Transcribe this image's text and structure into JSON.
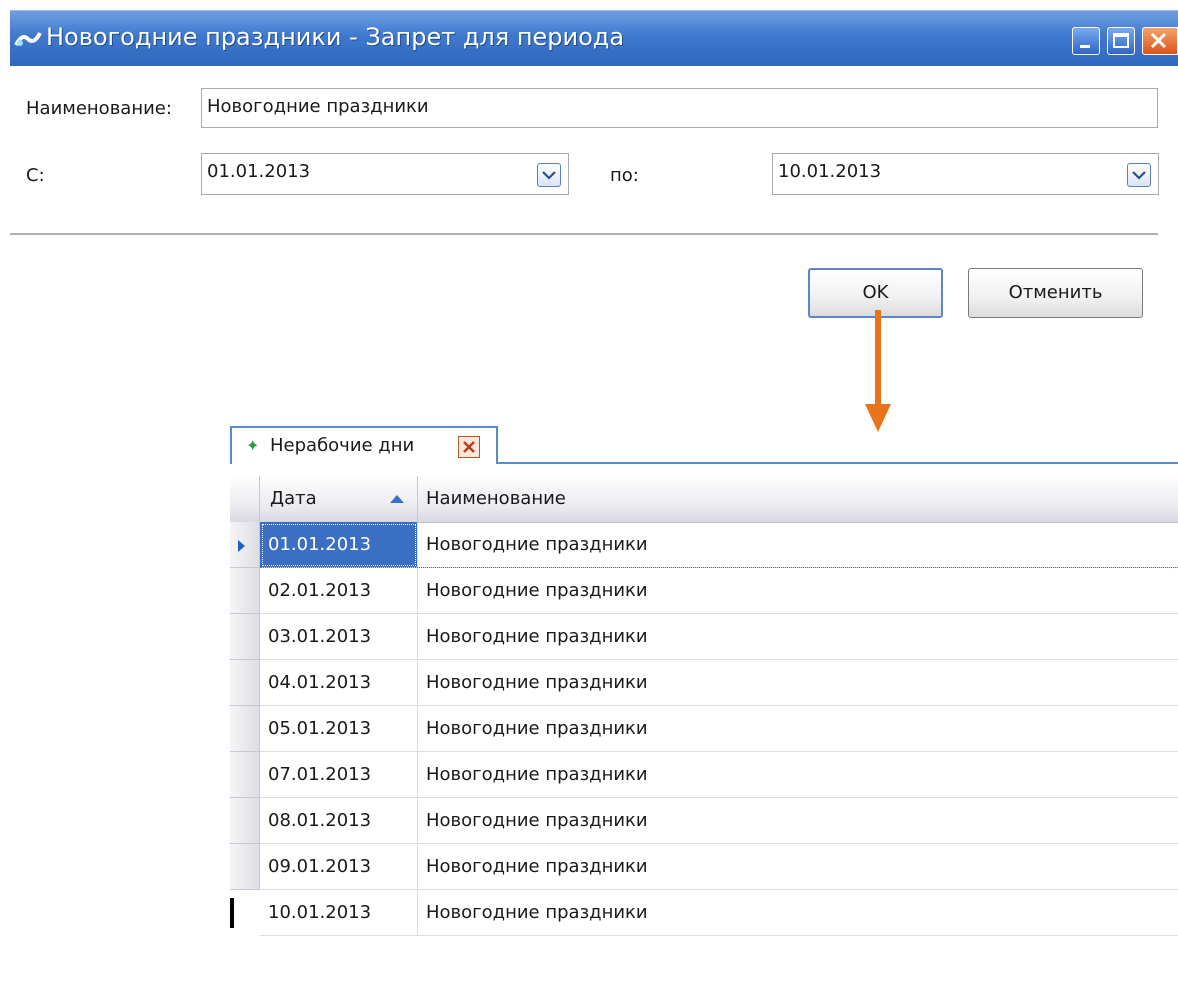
{
  "window": {
    "title": "Новогодние праздники - Запрет для периода",
    "controls": [
      "minimize",
      "maximize",
      "close"
    ]
  },
  "form": {
    "name_label": "Наименование:",
    "name_value": "Новогодние праздники",
    "from_label": "С:",
    "from_value": "01.01.2013",
    "to_label": "по:",
    "to_value": "10.01.2013"
  },
  "buttons": {
    "ok": "OK",
    "cancel": "Отменить"
  },
  "annotation": {
    "arrow_color": "#e8731a"
  },
  "tab": {
    "label": "Нерабочие дни",
    "icon": "star-icon"
  },
  "grid": {
    "columns": [
      "Дата",
      "Наименование"
    ],
    "sort_column": "Дата",
    "sort_direction": "ascending",
    "selected_row": 0,
    "rows": [
      {
        "date": "01.01.2013",
        "name": "Новогодние праздники"
      },
      {
        "date": "02.01.2013",
        "name": "Новогодние праздники"
      },
      {
        "date": "03.01.2013",
        "name": "Новогодние праздники"
      },
      {
        "date": "04.01.2013",
        "name": "Новогодние праздники"
      },
      {
        "date": "05.01.2013",
        "name": "Новогодние праздники"
      },
      {
        "date": "07.01.2013",
        "name": "Новогодние праздники"
      },
      {
        "date": "08.01.2013",
        "name": "Новогодние праздники"
      },
      {
        "date": "09.01.2013",
        "name": "Новогодние праздники"
      },
      {
        "date": "10.01.2013",
        "name": "Новогодние праздники"
      }
    ]
  },
  "colors": {
    "titlebar": "#3f78cd",
    "selection": "#3b6fc4",
    "tab_border": "#5a8cc8"
  }
}
